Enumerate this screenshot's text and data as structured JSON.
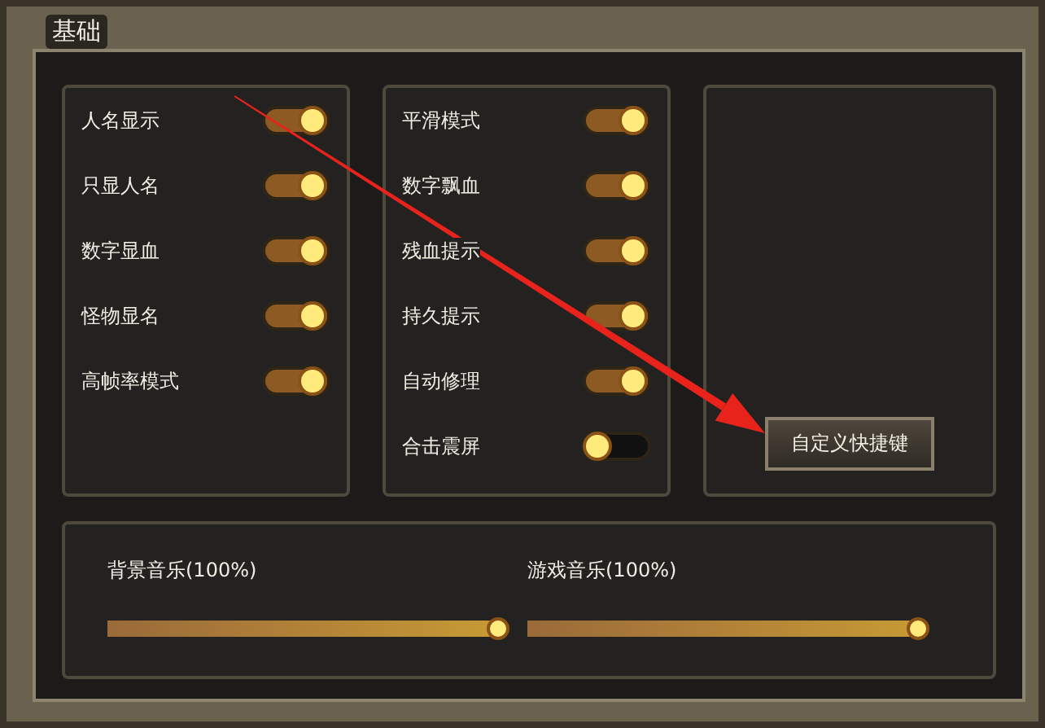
{
  "window": {
    "title": "基础"
  },
  "toggle_columns": [
    {
      "toggles": [
        {
          "label": "人名显示",
          "on": true
        },
        {
          "label": "只显人名",
          "on": true
        },
        {
          "label": "数字显血",
          "on": true
        },
        {
          "label": "怪物显名",
          "on": true
        },
        {
          "label": "高帧率模式",
          "on": true
        }
      ]
    },
    {
      "toggles": [
        {
          "label": "平滑模式",
          "on": true
        },
        {
          "label": "数字飘血",
          "on": true
        },
        {
          "label": "残血提示",
          "on": true
        },
        {
          "label": "持久提示",
          "on": true
        },
        {
          "label": "自动修理",
          "on": true
        },
        {
          "label": "合击震屏",
          "on": false
        }
      ]
    }
  ],
  "shortcut_button": {
    "label": "自定义快捷键"
  },
  "sliders": [
    {
      "label": "背景音乐(100%)",
      "level": 1
    },
    {
      "label": "游戏音乐(100%)",
      "level": 1
    }
  ]
}
